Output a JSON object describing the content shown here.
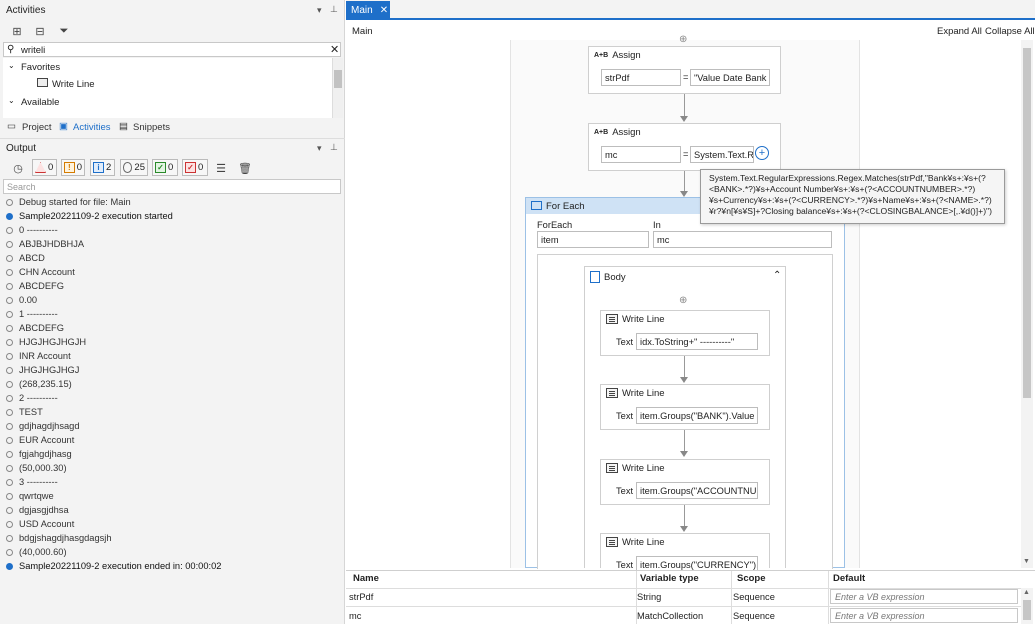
{
  "activities_panel": {
    "title": "Activities",
    "search_value": "writeli",
    "favorites": "Favorites",
    "favorite_item": "Write Line",
    "available": "Available"
  },
  "bottom_tabs": [
    "Project",
    "Activities",
    "Snippets"
  ],
  "output_panel": {
    "title": "Output",
    "filters": {
      "errors": "0",
      "warnings": "0",
      "info": "2",
      "trace": "25",
      "verbose_ok": "0",
      "verbose_err": "0"
    },
    "search_placeholder": "Search"
  },
  "log_lines": [
    {
      "t": "Debug started for file: Main",
      "k": "grey"
    },
    {
      "t": "Sample20221109-2 execution started",
      "k": "blue"
    },
    {
      "t": "0 ----------",
      "k": "grey"
    },
    {
      "t": "ABJBJHDBHJA",
      "k": "grey"
    },
    {
      "t": "ABCD",
      "k": "grey"
    },
    {
      "t": "CHN Account",
      "k": "grey"
    },
    {
      "t": "ABCDEFG",
      "k": "grey"
    },
    {
      "t": "0.00",
      "k": "grey"
    },
    {
      "t": "1 ----------",
      "k": "grey"
    },
    {
      "t": "ABCDEFG",
      "k": "grey"
    },
    {
      "t": "HJGJHGJHGJH",
      "k": "grey"
    },
    {
      "t": "INR Account",
      "k": "grey"
    },
    {
      "t": "JHGJHGJHGJ",
      "k": "grey"
    },
    {
      "t": "(268,235.15)",
      "k": "grey"
    },
    {
      "t": "2 ----------",
      "k": "grey"
    },
    {
      "t": "TEST",
      "k": "grey"
    },
    {
      "t": "gdjhagdjhsagd",
      "k": "grey"
    },
    {
      "t": "EUR Account",
      "k": "grey"
    },
    {
      "t": "fgjahgdjhasg",
      "k": "grey"
    },
    {
      "t": "(50,000.30)",
      "k": "grey"
    },
    {
      "t": "3 ----------",
      "k": "grey"
    },
    {
      "t": "qwrtqwe",
      "k": "grey"
    },
    {
      "t": "dgjasgjdhsa",
      "k": "grey"
    },
    {
      "t": "USD Account",
      "k": "grey"
    },
    {
      "t": "bdgjshagdjhasgdagsjh",
      "k": "grey"
    },
    {
      "t": "(40,000.60)",
      "k": "grey"
    },
    {
      "t": "Sample20221109-2 execution ended in: 00:00:02",
      "k": "blue"
    }
  ],
  "designer": {
    "tab": "Main",
    "breadcrumb": "Main",
    "expand_all": "Expand All",
    "collapse_all": "Collapse All"
  },
  "assign1": {
    "title": "Assign",
    "to": "strPdf",
    "eq": "=",
    "value": "\"Value Date Bank V"
  },
  "assign2": {
    "title": "Assign",
    "to": "mc",
    "eq": "=",
    "value": "System.Text.Re"
  },
  "tooltip": "System.Text.RegularExpressions.Regex.Matches(strPdf,\"Bank¥s+:¥s+(?<BANK>.*?)¥s+Account Number¥s+:¥s+(?<ACCOUNTNUMBER>.*?)¥s+Currency¥s+:¥s+(?<CURRENCY>.*?)¥s+Name¥s+:¥s+(?<NAME>.*?)¥r?¥n[¥s¥S]+?Closing balance¥s+:¥s+(?<CLOSINGBALANCE>[,.¥d()]+)\")",
  "foreach": {
    "title": "For Each",
    "foreach_label": "ForEach",
    "item": "item",
    "in_label": "In",
    "in_value": "mc"
  },
  "body": {
    "title": "Body"
  },
  "writelines": [
    {
      "title": "Write Line",
      "label": "Text",
      "value": "idx.ToString+\" ----------\""
    },
    {
      "title": "Write Line",
      "label": "Text",
      "value": "item.Groups(\"BANK\").Value"
    },
    {
      "title": "Write Line",
      "label": "Text",
      "value": "item.Groups(\"ACCOUNTNUM"
    },
    {
      "title": "Write Line",
      "label": "Text",
      "value": "item.Groups(\"CURRENCY\").Va"
    }
  ],
  "variables": {
    "headers": [
      "Name",
      "Variable type",
      "Scope",
      "Default"
    ],
    "rows": [
      {
        "name": "strPdf",
        "type": "String",
        "scope": "Sequence",
        "default_placeholder": "Enter a VB expression"
      },
      {
        "name": "mc",
        "type": "MatchCollection",
        "scope": "Sequence",
        "default_placeholder": "Enter a VB expression"
      }
    ]
  }
}
